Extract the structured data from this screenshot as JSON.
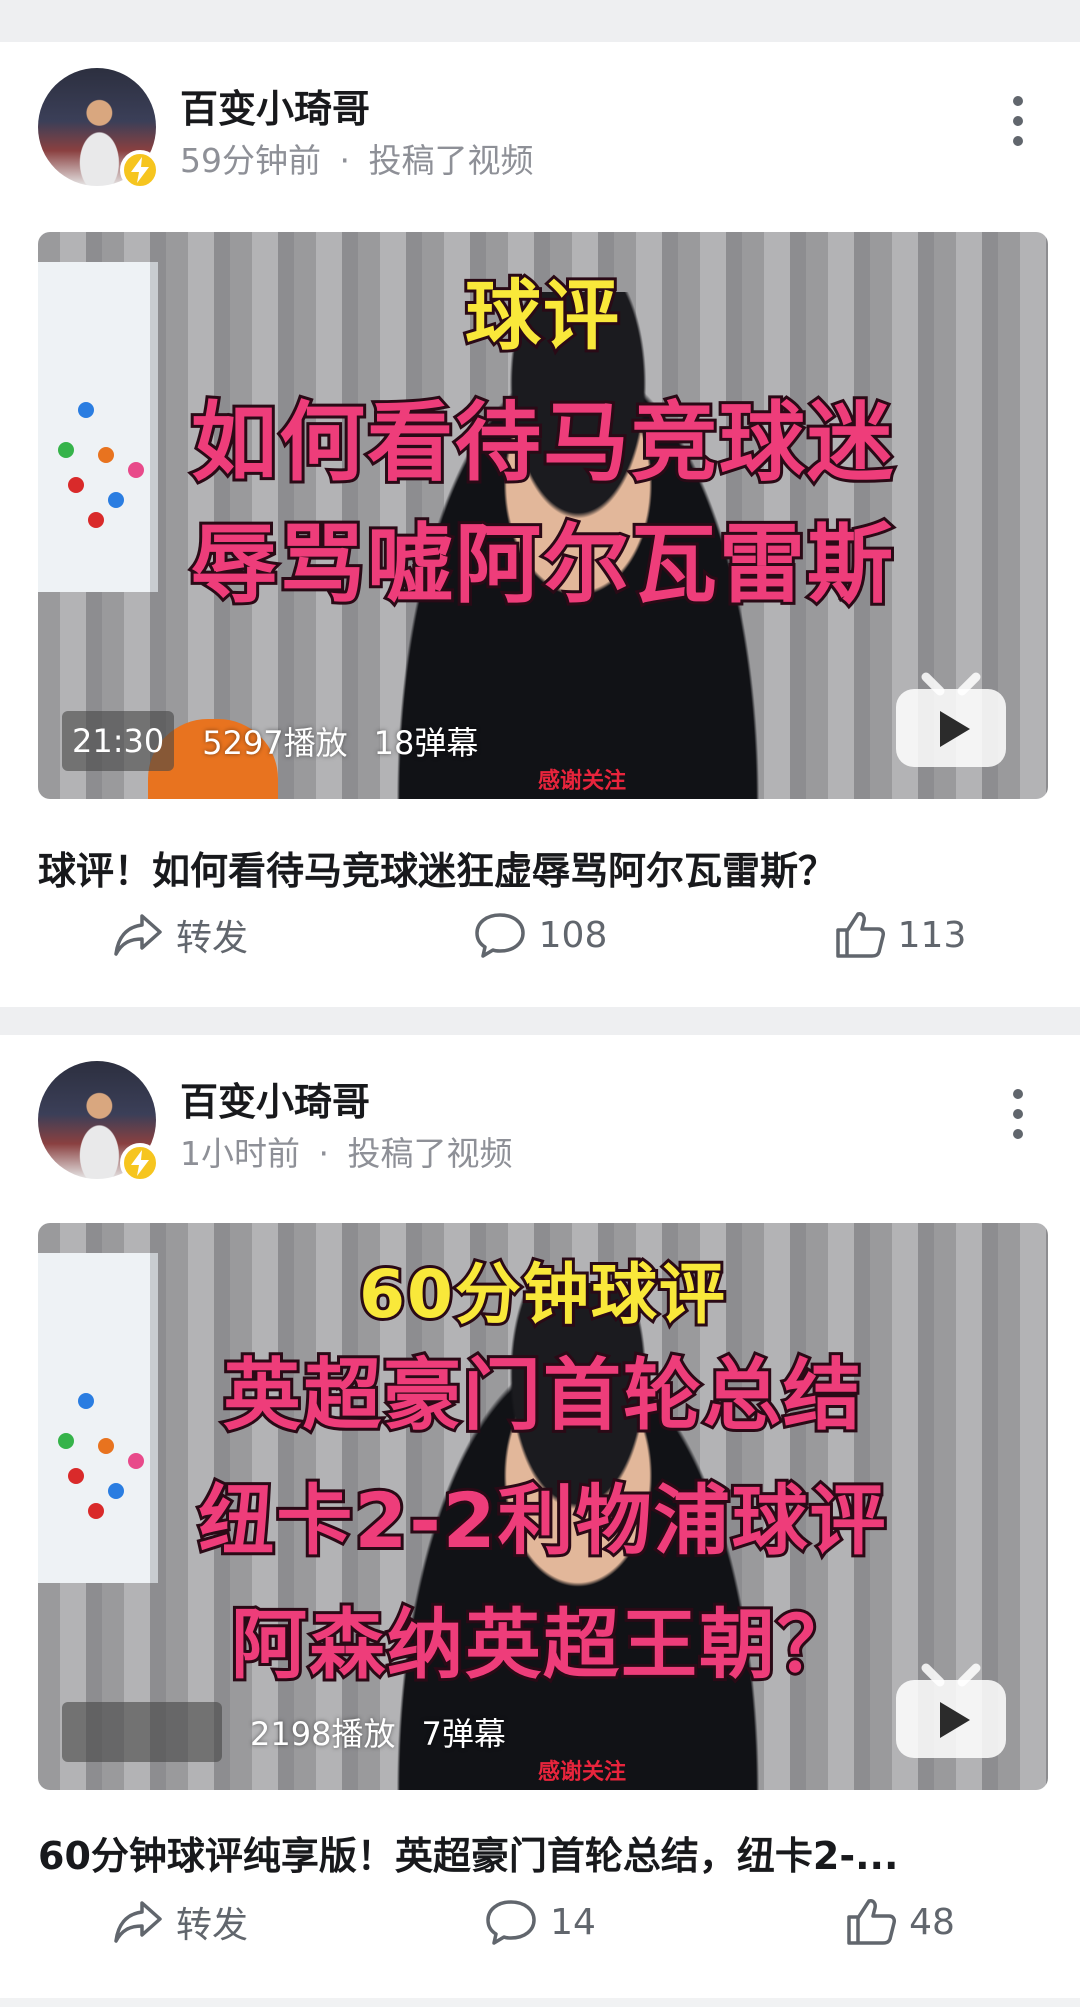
{
  "posts": [
    {
      "author": "百变小琦哥",
      "time": "59分钟前",
      "action": "投稿了视频",
      "thumb_overlay": [
        "球评",
        "如何看待马竞球迷",
        "辱骂嘘阿尔瓦雷斯"
      ],
      "duration": "21:30",
      "plays": "5297播放",
      "danmaku": "18弹幕",
      "stamp": "感谢关注",
      "title": "球评！如何看待马竞球迷狂虚辱骂阿尔瓦雷斯？",
      "share_label": "转发",
      "comments": "108",
      "likes": "113"
    },
    {
      "author": "百变小琦哥",
      "time": "1小时前",
      "action": "投稿了视频",
      "thumb_overlay": [
        "60分钟球评",
        "英超豪门首轮总结",
        "纽卡2-2利物浦球评",
        "阿森纳英超王朝？"
      ],
      "duration": "",
      "plays": "2198播放",
      "danmaku": "7弹幕",
      "stamp": "感谢关注",
      "title": "60分钟球评纯享版！英超豪门首轮总结，纽卡2-...",
      "share_label": "转发",
      "comments": "14",
      "likes": "48"
    }
  ],
  "separator": "·",
  "colors": {
    "accent_yellow": "#f6c51f",
    "overlay_pink": "#ee3d7a",
    "overlay_yellow": "#f9e83a"
  },
  "icons": [
    "lightning-icon",
    "more-vertical-icon",
    "bilibili-tv-icon",
    "share-icon",
    "comment-icon",
    "like-icon"
  ]
}
